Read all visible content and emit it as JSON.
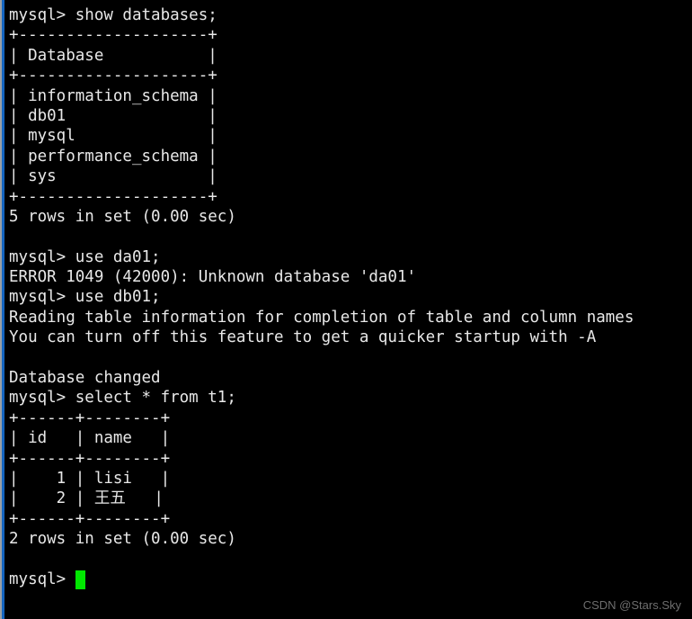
{
  "terminal": {
    "prompt": "mysql>",
    "cursor_color": "#00e800",
    "text_color": "#e8e8e8",
    "background_color": "#000000",
    "accent_color": "#1565c0",
    "lines": [
      "mysql> show databases;",
      "+--------------------+",
      "| Database           |",
      "+--------------------+",
      "| information_schema |",
      "| db01               |",
      "| mysql              |",
      "| performance_schema |",
      "| sys                |",
      "+--------------------+",
      "5 rows in set (0.00 sec)",
      "",
      "mysql> use da01;",
      "ERROR 1049 (42000): Unknown database 'da01'",
      "mysql> use db01;",
      "Reading table information for completion of table and column names",
      "You can turn off this feature to get a quicker startup with -A",
      "",
      "Database changed",
      "mysql> select * from t1;",
      "+------+--------+",
      "| id   | name   |",
      "+------+--------+",
      "|    1 | lisi   |",
      "|    2 | 王五   |",
      "+------+--------+",
      "2 rows in set (0.00 sec)",
      ""
    ],
    "final_prompt": "mysql> ",
    "commands": [
      "show databases;",
      "use da01;",
      "use db01;",
      "select * from t1;"
    ],
    "databases": [
      "information_schema",
      "db01",
      "mysql",
      "performance_schema",
      "sys"
    ],
    "databases_result": "5 rows in set (0.00 sec)",
    "error_message": "ERROR 1049 (42000): Unknown database 'da01'",
    "notice_lines": [
      "Reading table information for completion of table and column names",
      "You can turn off this feature to get a quicker startup with -A",
      "Database changed"
    ],
    "table": {
      "columns": [
        "id",
        "name"
      ],
      "rows": [
        [
          "1",
          "lisi"
        ],
        [
          "2",
          "王五"
        ]
      ],
      "result": "2 rows in set (0.00 sec)"
    }
  },
  "watermark": {
    "text": "CSDN @Stars.Sky"
  }
}
